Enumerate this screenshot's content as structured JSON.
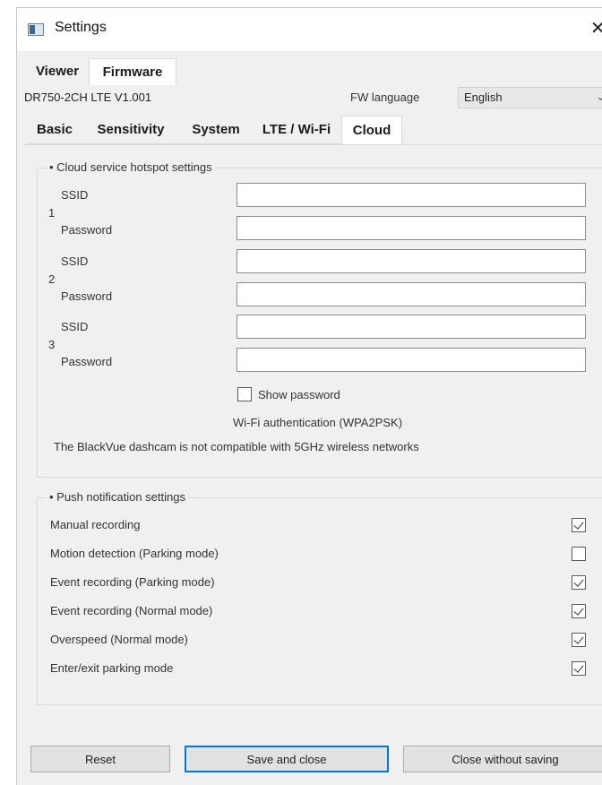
{
  "window": {
    "title": "Settings",
    "icon": "settings-app-icon",
    "close_glyph": "✕"
  },
  "top_tabs": [
    {
      "label": "Viewer",
      "active": false
    },
    {
      "label": "Firmware",
      "active": true
    }
  ],
  "firmware": {
    "model": "DR750-2CH LTE  V1.001",
    "lang_label": "FW language",
    "lang_value": "English"
  },
  "sub_tabs": [
    {
      "label": "Basic",
      "active": false
    },
    {
      "label": "Sensitivity",
      "active": false
    },
    {
      "label": "System",
      "active": false
    },
    {
      "label": "LTE / Wi-Fi",
      "active": false
    },
    {
      "label": "Cloud",
      "active": true
    }
  ],
  "hotspot": {
    "title": "• Cloud service hotspot settings",
    "entries": [
      {
        "num": "1",
        "ssid_label": "SSID",
        "password_label": "Password",
        "ssid": "",
        "password": ""
      },
      {
        "num": "2",
        "ssid_label": "SSID",
        "password_label": "Password",
        "ssid": "",
        "password": ""
      },
      {
        "num": "3",
        "ssid_label": "SSID",
        "password_label": "Password",
        "ssid": "",
        "password": ""
      }
    ],
    "show_password_label": "Show password",
    "show_password_checked": false,
    "auth_text": "Wi-Fi authentication (WPA2PSK)",
    "compat_note": "The BlackVue dashcam is not compatible with 5GHz wireless networks"
  },
  "push": {
    "title": "• Push notification settings",
    "items": [
      {
        "label": "Manual recording",
        "checked": true
      },
      {
        "label": "Motion detection (Parking mode)",
        "checked": false
      },
      {
        "label": "Event recording (Parking mode)",
        "checked": true
      },
      {
        "label": "Event recording (Normal mode)",
        "checked": true
      },
      {
        "label": "Overspeed (Normal mode)",
        "checked": true
      },
      {
        "label": "Enter/exit parking mode",
        "checked": true
      }
    ]
  },
  "buttons": {
    "reset": "Reset",
    "save": "Save and close",
    "close": "Close without saving"
  },
  "colors": {
    "focus_border": "#0078d7",
    "window_bg": "#f0f0f0"
  }
}
